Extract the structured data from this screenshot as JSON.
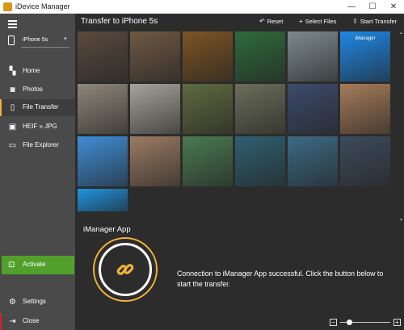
{
  "window": {
    "title": "iDevice Manager",
    "controls": [
      "—",
      "☐",
      "✕"
    ]
  },
  "sidebar": {
    "device": "iPhone 5s",
    "items": [
      {
        "label": "Home",
        "icon": "home-icon"
      },
      {
        "label": "Photos",
        "icon": "camera-icon"
      },
      {
        "label": "File Transfer",
        "icon": "phone-icon",
        "active": true
      },
      {
        "label": "HEIF » JPG",
        "icon": "image-icon"
      },
      {
        "label": "File Explorer",
        "icon": "folder-icon"
      }
    ],
    "activate": "Activate",
    "settings": "Settings",
    "close": "Close"
  },
  "main": {
    "title": "Transfer to iPhone 5s",
    "toolbar": {
      "reset": "Reset",
      "select_files": "Select Files",
      "start_transfer": "Start Transfer"
    },
    "thumbnail_colors": [
      [
        "#5a4a3e",
        "#6e5843",
        "#7b5424",
        "#2f6b3a",
        "#7d8a8f",
        "#1e88e5"
      ],
      [
        "#8e8778",
        "#a6a39a",
        "#5e6b3f",
        "#6b6e5a",
        "#3c4b6c",
        "#a67c5a"
      ],
      [
        "#3f8ed6",
        "#9b7b63",
        "#4a7a50",
        "#2f6072",
        "#3b6b84",
        "#3d4b5c"
      ],
      [
        "#1f94e0"
      ]
    ],
    "thumb_overlay": {
      "app_name": "iManager"
    },
    "app_section": {
      "title": "iManager App",
      "message": "Connection to iManager App successful. Click the button below to start the transfer."
    },
    "zoom": {
      "minus": "−",
      "plus": "+",
      "level": 0.18
    }
  },
  "colors": {
    "accent": "#f2b233",
    "sidebar_bg": "#4a4a4a",
    "main_bg": "#2c2c2c",
    "activate_bg": "#52a02c",
    "close_marker": "#d02424"
  }
}
